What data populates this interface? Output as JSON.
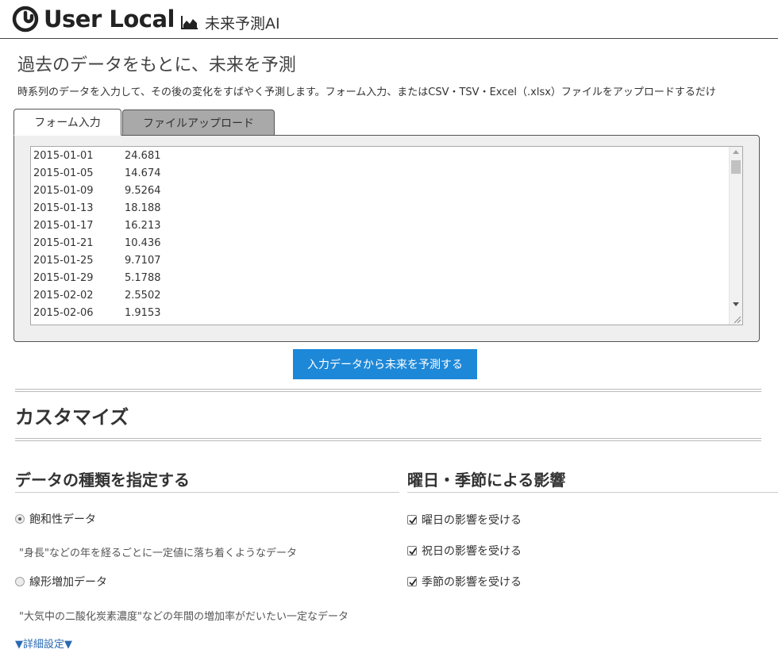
{
  "header": {
    "brand_name": "User Local",
    "product_name": "未来予測AI"
  },
  "intro": {
    "title": "過去のデータをもとに、未来を予測",
    "description": "時系列のデータを入力して、その後の変化をすばやく予測します。フォーム入力、またはCSV・TSV・Excel（.xlsx）ファイルをアップロードするだけ"
  },
  "tabs": [
    {
      "label": "フォーム入力",
      "active": true
    },
    {
      "label": "ファイルアップロード",
      "active": false
    }
  ],
  "data_input": {
    "rows": [
      {
        "date": "2015-01-01",
        "value": "24.681"
      },
      {
        "date": "2015-01-05",
        "value": "14.674"
      },
      {
        "date": "2015-01-09",
        "value": "9.5264"
      },
      {
        "date": "2015-01-13",
        "value": "18.188"
      },
      {
        "date": "2015-01-17",
        "value": "16.213"
      },
      {
        "date": "2015-01-21",
        "value": "10.436"
      },
      {
        "date": "2015-01-25",
        "value": "9.7107"
      },
      {
        "date": "2015-01-29",
        "value": "5.1788"
      },
      {
        "date": "2015-02-02",
        "value": "2.5502"
      },
      {
        "date": "2015-02-06",
        "value": "1.9153"
      }
    ]
  },
  "predict_button_label": "入力データから未来を予測する",
  "customize": {
    "title": "カスタマイズ",
    "data_type": {
      "heading": "データの種類を指定する",
      "options": [
        {
          "label": "飽和性データ",
          "hint": "\"身長\"などの年を経るごとに一定値に落ち着くようなデータ",
          "selected": true
        },
        {
          "label": "線形増加データ",
          "hint": "\"大気中の二酸化炭素濃度\"などの年間の増加率がだいたい一定なデータ",
          "selected": false
        }
      ]
    },
    "seasonality": {
      "heading": "曜日・季節による影響",
      "options": [
        {
          "label": "曜日の影響を受ける",
          "checked": true
        },
        {
          "label": "祝日の影響を受ける",
          "checked": true
        },
        {
          "label": "季節の影響を受ける",
          "checked": true
        }
      ]
    },
    "detail_link": "▼詳細設定▼"
  },
  "colors": {
    "accent": "#1e88d8",
    "link": "#2a6ab3",
    "inactive_tab": "#a9a9a9"
  }
}
